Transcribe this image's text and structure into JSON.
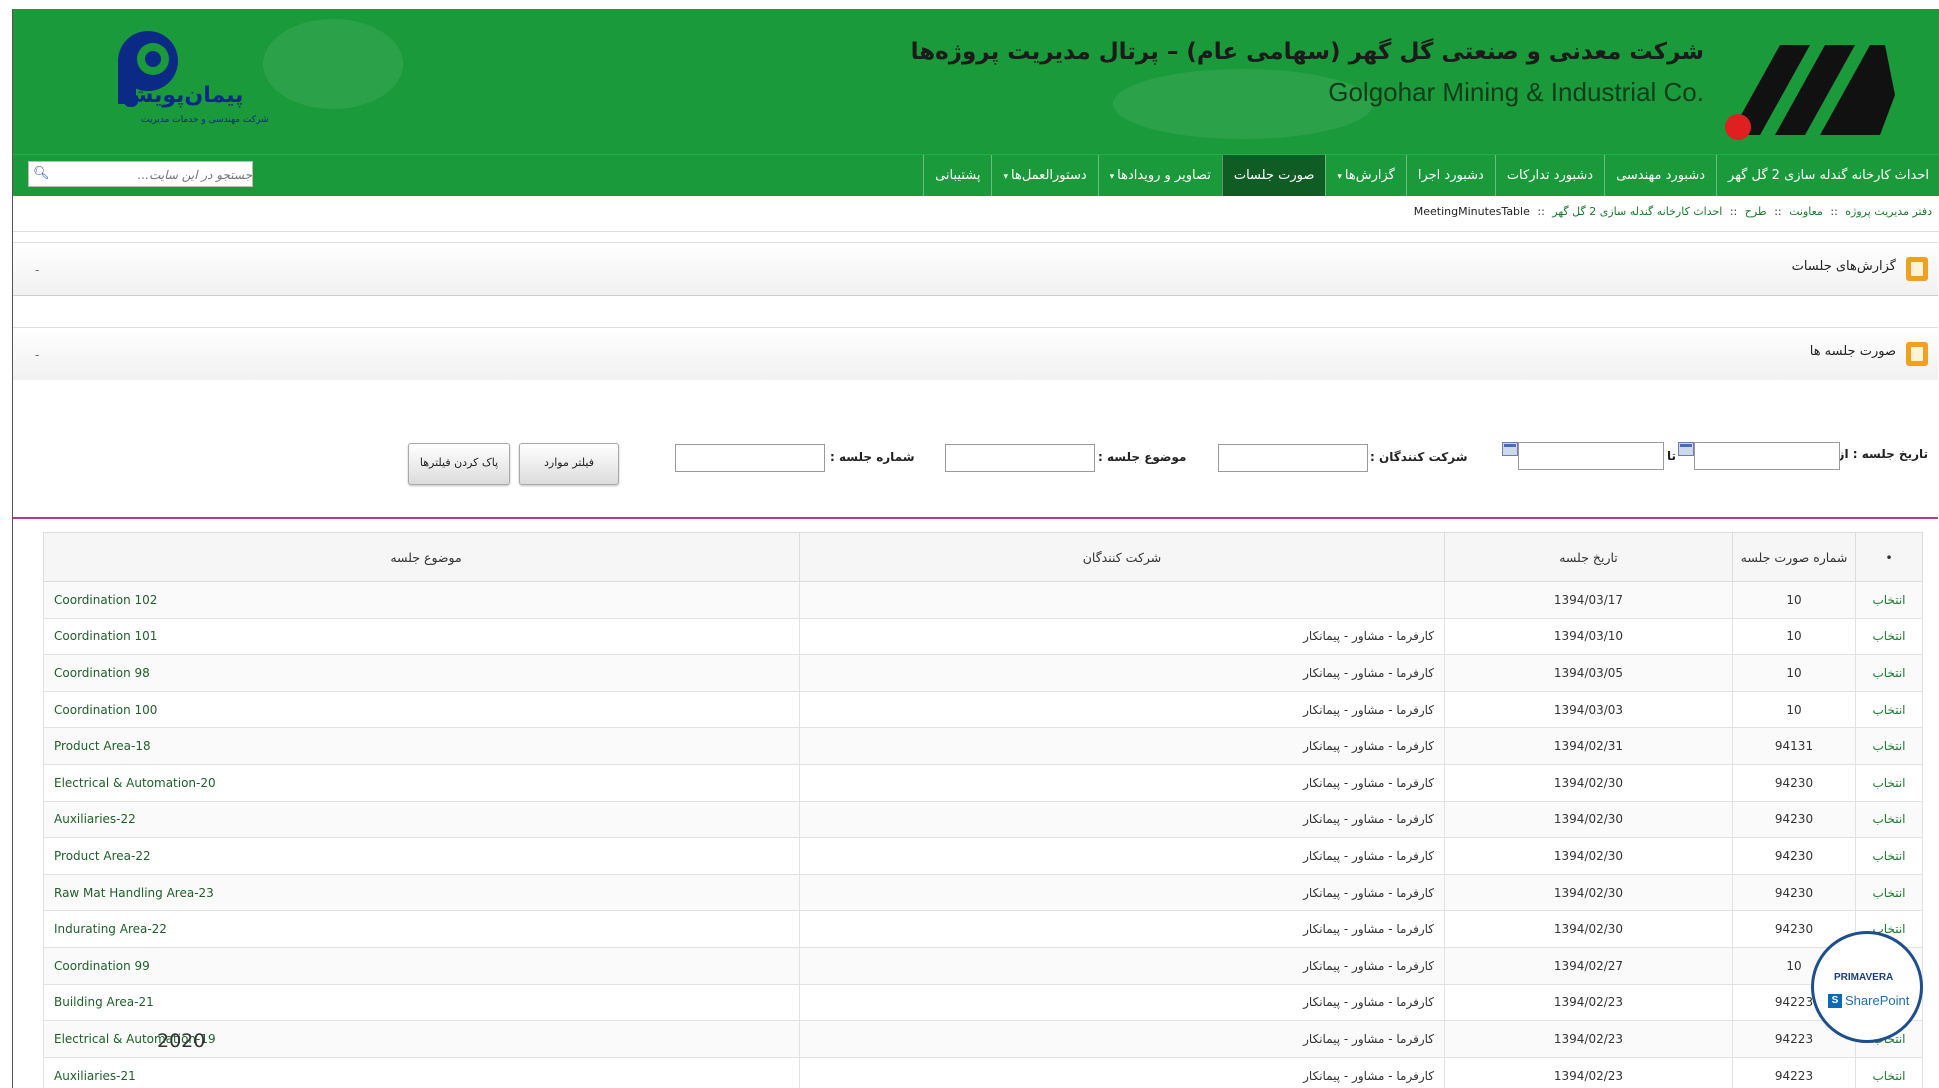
{
  "header": {
    "title_fa": "شرکت معدنی و صنعتی گل گهر (سهامی عام) – پرتال مدیریت پروژه‌ها",
    "title_en": "Golgohar Mining & Industrial Co.",
    "logo_left_text": "پیمان‌پویش",
    "logo_left_sub": "شرکت مهندسی و خدمات مدیریت"
  },
  "nav": {
    "items": [
      {
        "label": "احداث کارخانه گندله سازی 2 گل گهر",
        "dropdown": false,
        "active": false
      },
      {
        "label": "دشبورد مهندسی",
        "dropdown": false,
        "active": false
      },
      {
        "label": "دشبورد تدارکات",
        "dropdown": false,
        "active": false
      },
      {
        "label": "دشبورد اجرا",
        "dropdown": false,
        "active": false
      },
      {
        "label": "گزارش‌ها",
        "dropdown": true,
        "active": false
      },
      {
        "label": "صورت جلسات",
        "dropdown": false,
        "active": true
      },
      {
        "label": "تصاویر و رویدادها",
        "dropdown": true,
        "active": false
      },
      {
        "label": "دستورالعمل‌ها",
        "dropdown": true,
        "active": false
      },
      {
        "label": "پشتیبانی",
        "dropdown": false,
        "active": false
      }
    ],
    "search_placeholder": "جستجو در این سایت..."
  },
  "breadcrumb": {
    "items": [
      "دفتر مدیریت پروژه",
      "معاونت",
      "طرح",
      "احداث کارخانه گندله سازی 2 گل گهر"
    ],
    "separator": "::",
    "current": "MeetingMinutesTable"
  },
  "panels": {
    "reports_title": "گزارش‌های جلسات",
    "minutes_title": "صورت جلسه ها",
    "toggle_symbol": "-"
  },
  "filters": {
    "date_from_label": "تاریخ جلسه : از",
    "date_to_label": "تا",
    "participants_label": "شرکت کنندگان :",
    "subject_label": "موضوع جلسه :",
    "number_label": "شماره جلسه :",
    "filter_button": "فیلتر موارد",
    "clear_button": "پاک کردن فیلترها"
  },
  "table": {
    "headers": {
      "select": "•",
      "number": "شماره صورت جلسه",
      "date": "تاریخ جلسه",
      "participants": "شرکت کنندگان",
      "subject": "موضوع جلسه"
    },
    "select_label": "انتخاب",
    "rows": [
      {
        "number": "10",
        "date": "1394/03/17",
        "participants": "",
        "subject": "Coordination 102"
      },
      {
        "number": "10",
        "date": "1394/03/10",
        "participants": "کارفرما - مشاور - پیمانکار",
        "subject": "Coordination 101"
      },
      {
        "number": "10",
        "date": "1394/03/05",
        "participants": "کارفرما - مشاور - پیمانکار",
        "subject": "Coordination 98"
      },
      {
        "number": "10",
        "date": "1394/03/03",
        "participants": "کارفرما - مشاور - پیمانکار",
        "subject": "Coordination 100"
      },
      {
        "number": "94131",
        "date": "1394/02/31",
        "participants": "کارفرما - مشاور - پیمانکار",
        "subject": "Product Area-18"
      },
      {
        "number": "94230",
        "date": "1394/02/30",
        "participants": "کارفرما - مشاور - پیمانکار",
        "subject": "Electrical & Automation-20"
      },
      {
        "number": "94230",
        "date": "1394/02/30",
        "participants": "کارفرما - مشاور - پیمانکار",
        "subject": "Auxiliaries-22"
      },
      {
        "number": "94230",
        "date": "1394/02/30",
        "participants": "کارفرما - مشاور - پیمانکار",
        "subject": "Product Area-22"
      },
      {
        "number": "94230",
        "date": "1394/02/30",
        "participants": "کارفرما - مشاور - پیمانکار",
        "subject": "Raw Mat Handling Area-23"
      },
      {
        "number": "94230",
        "date": "1394/02/30",
        "participants": "کارفرما - مشاور - پیمانکار",
        "subject": "Indurating Area-22"
      },
      {
        "number": "10",
        "date": "1394/02/27",
        "participants": "کارفرما - مشاور - پیمانکار",
        "subject": "Coordination 99"
      },
      {
        "number": "94223",
        "date": "1394/02/23",
        "participants": "کارفرما - مشاور - پیمانکار",
        "subject": "Building Area-21"
      },
      {
        "number": "94223",
        "date": "1394/02/23",
        "participants": "کارفرما - مشاور - پیمانکار",
        "subject": "Electrical & Automation-19"
      },
      {
        "number": "94223",
        "date": "1394/02/23",
        "participants": "کارفرما - مشاور - پیمانکار",
        "subject": "Auxiliaries-21"
      }
    ]
  },
  "overlay": {
    "primavera": "PRIMAVERA",
    "sharepoint": "SharePoint",
    "sharepoint_mark": "S",
    "year": "2020"
  },
  "colors": {
    "header_green": "#1a9a3a",
    "nav_active": "#0f5c25",
    "link_green": "#1a7a2e",
    "accent_magenta": "#b23b8c",
    "panel_icon": "#f0a020"
  }
}
